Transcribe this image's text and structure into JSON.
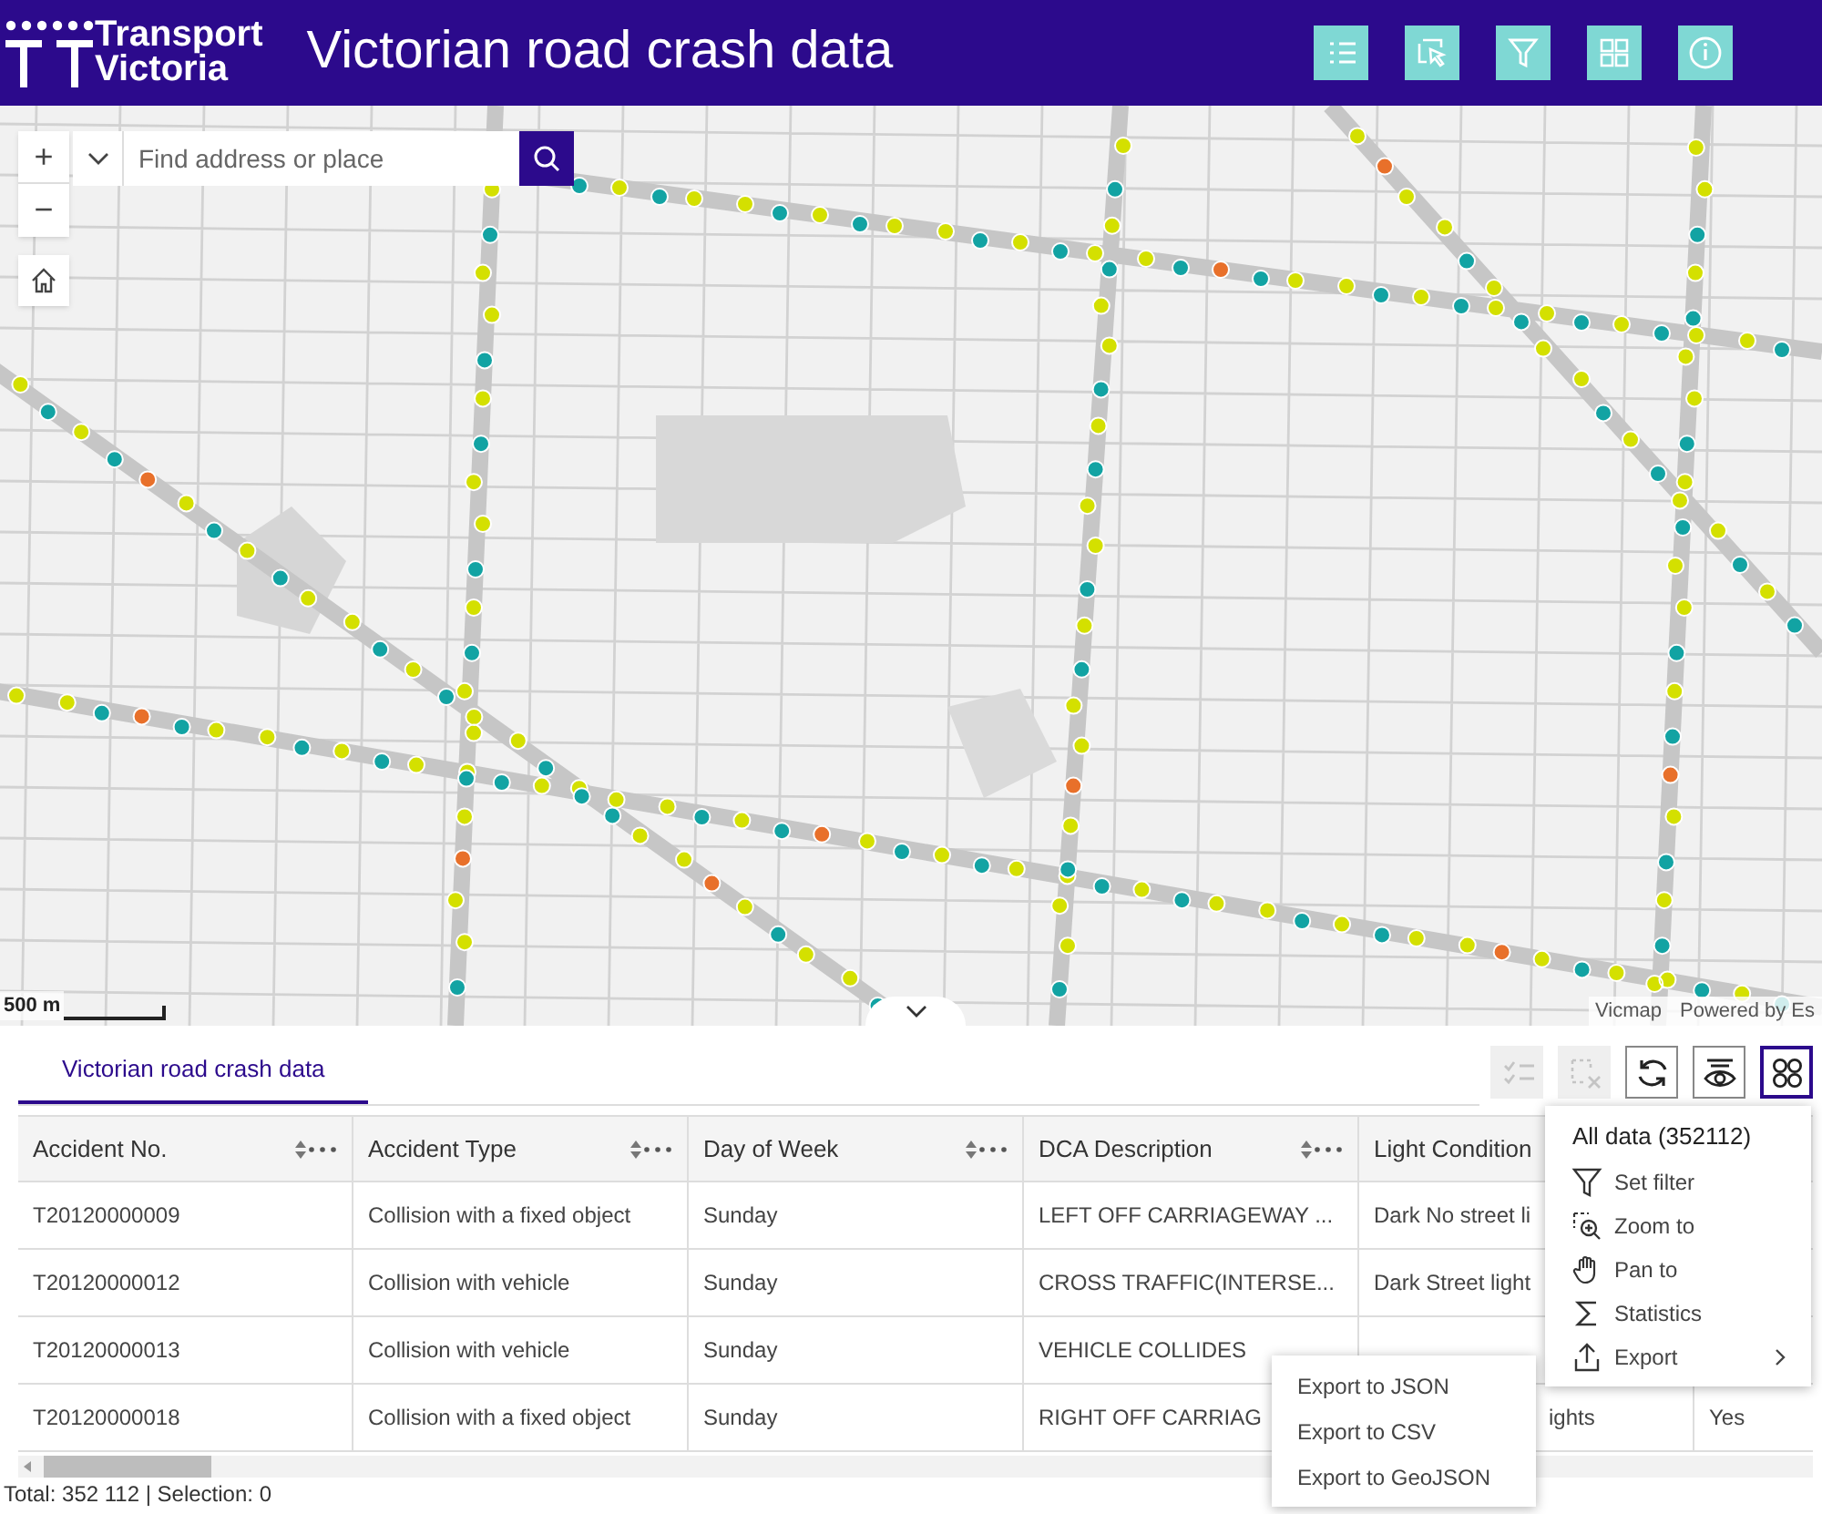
{
  "header": {
    "brand": [
      "Transport",
      "Victoria"
    ],
    "title": "Victorian road crash data",
    "tools": [
      {
        "kind": "list"
      },
      {
        "kind": "select"
      },
      {
        "kind": "filter"
      },
      {
        "kind": "grid"
      },
      {
        "kind": "info"
      }
    ]
  },
  "map": {
    "kind": "picture",
    "zoom_in": "+",
    "zoom_out": "−",
    "search": {
      "placeholder": "Find address or place"
    },
    "scale": "500 m",
    "attribution": [
      "Vicmap",
      "Powered by Es"
    ]
  },
  "table_panel": {
    "tabs": [
      {
        "label": "Victorian road crash data",
        "selected": true
      }
    ],
    "toolbar": [
      {
        "kind": "select-all",
        "disabled": true,
        "selected": false
      },
      {
        "kind": "clear-selection",
        "disabled": true,
        "selected": false
      },
      {
        "kind": "refresh",
        "disabled": false,
        "selected": false
      },
      {
        "kind": "columns",
        "disabled": false,
        "selected": false
      },
      {
        "kind": "more",
        "disabled": false,
        "selected": true
      }
    ],
    "columns": [
      {
        "label": "Accident No."
      },
      {
        "label": "Accident Type"
      },
      {
        "label": "Day of Week"
      },
      {
        "label": "DCA Description"
      },
      {
        "label": "Light Condition"
      }
    ],
    "rows": [
      [
        "T20120000009",
        "Collision with a fixed object",
        "Sunday",
        "LEFT OFF CARRIAGEWAY ...",
        "Dark No street li",
        null
      ],
      [
        "T20120000012",
        "Collision with vehicle",
        "Sunday",
        "CROSS TRAFFIC(INTERSE...",
        "Dark Street light",
        null
      ],
      [
        "T20120000013",
        "Collision with vehicle",
        "Sunday",
        "VEHICLE COLLIDES",
        null,
        null
      ],
      [
        "T20120000018",
        "Collision with a fixed object",
        "Sunday",
        "RIGHT OFF CARRIAG",
        {
          "text": "ights",
          "kind": "tail"
        },
        "Yes"
      ]
    ],
    "menu": {
      "title": "All data (352112)",
      "items": [
        {
          "label": "Set filter",
          "submenu": false
        },
        {
          "label": "Zoom to",
          "submenu": false
        },
        {
          "label": "Pan to",
          "submenu": false
        },
        {
          "label": "Statistics",
          "submenu": false
        },
        {
          "label": "Export",
          "submenu": true
        }
      ]
    },
    "submenu": [
      "Export to JSON",
      "Export to CSV",
      "Export to GeoJSON"
    ],
    "footer": "Total: 352 112 | Selection: 0"
  }
}
